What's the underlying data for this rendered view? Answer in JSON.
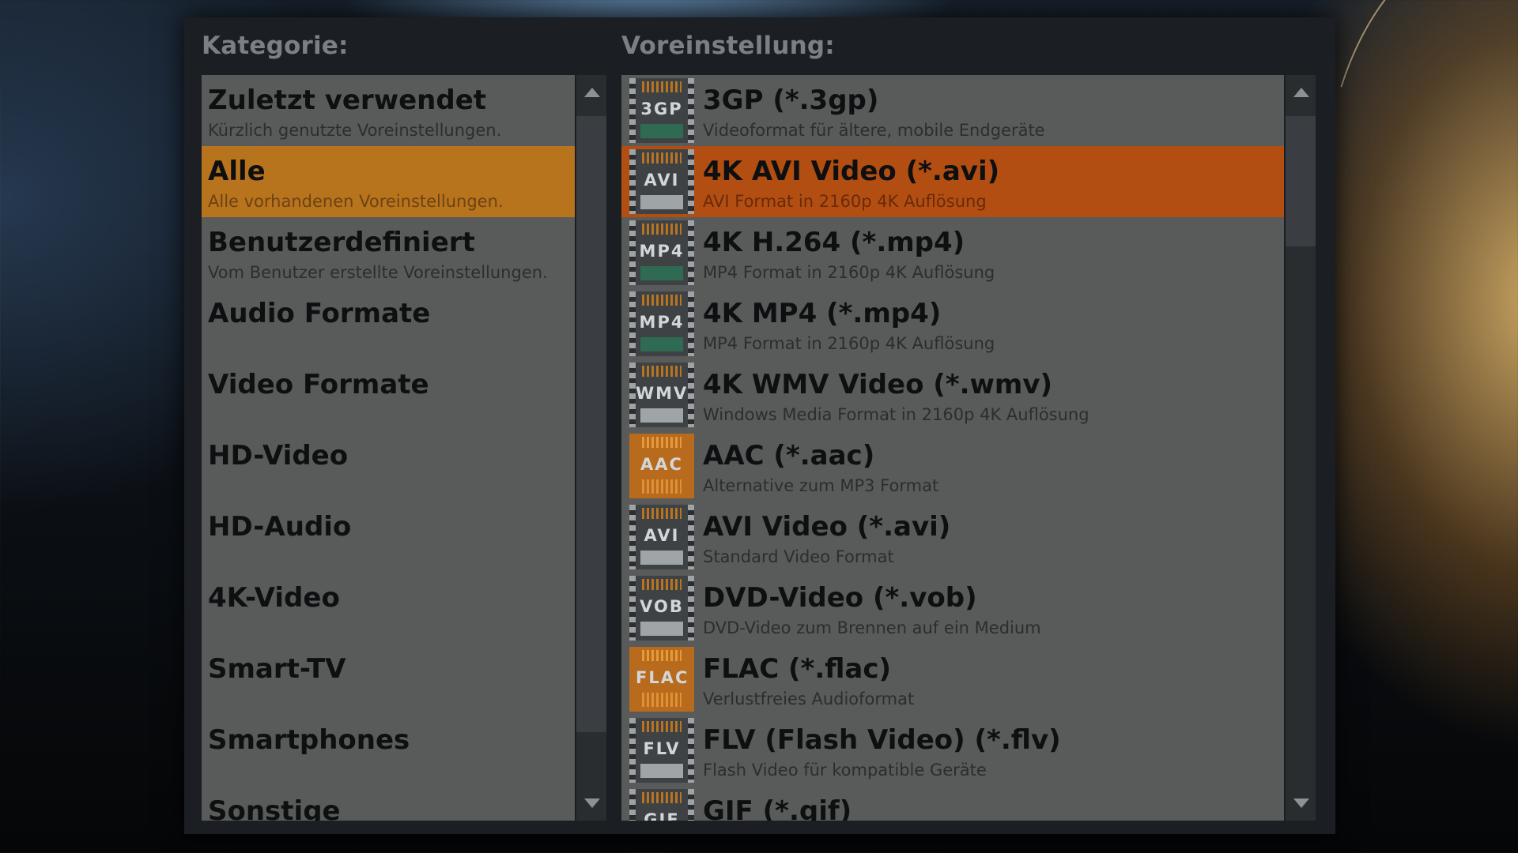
{
  "dialog": {
    "category_header": "Kategorie:",
    "preset_header": "Voreinstellung:"
  },
  "categories": [
    {
      "label": "Zuletzt verwendet",
      "desc": "Kürzlich genutzte Voreinstellungen.",
      "selected": false
    },
    {
      "label": "Alle",
      "desc": "Alle vorhandenen Voreinstellungen.",
      "selected": true
    },
    {
      "label": "Benutzerdefiniert",
      "desc": "Vom Benutzer erstellte Voreinstellungen.",
      "selected": false
    },
    {
      "label": "Audio Formate",
      "desc": "",
      "selected": false
    },
    {
      "label": "Video Formate",
      "desc": "",
      "selected": false
    },
    {
      "label": "HD-Video",
      "desc": "",
      "selected": false
    },
    {
      "label": "HD-Audio",
      "desc": "",
      "selected": false
    },
    {
      "label": "4K-Video",
      "desc": "",
      "selected": false
    },
    {
      "label": "Smart-TV",
      "desc": "",
      "selected": false
    },
    {
      "label": "Smartphones",
      "desc": "",
      "selected": false
    },
    {
      "label": "Sonstige",
      "desc": "",
      "selected": false
    }
  ],
  "presets": [
    {
      "label": "3GP (*.3gp)",
      "desc": "Videoformat für ältere, mobile Endgeräte",
      "icon_text": "3GP",
      "icon": "video-3gp-icon",
      "selected": false
    },
    {
      "label": "4K AVI Video (*.avi)",
      "desc": "AVI Format in 2160p 4K Auflösung",
      "icon_text": "AVI",
      "icon": "video-avi-icon",
      "selected": true
    },
    {
      "label": "4K H.264 (*.mp4)",
      "desc": "MP4 Format in 2160p 4K Auflösung",
      "icon_text": "MP4",
      "icon": "video-mp4-icon",
      "selected": false
    },
    {
      "label": "4K MP4 (*.mp4)",
      "desc": "MP4 Format in 2160p 4K Auflösung",
      "icon_text": "MP4",
      "icon": "video-mp4-icon",
      "selected": false
    },
    {
      "label": "4K WMV Video (*.wmv)",
      "desc": "Windows Media Format in 2160p 4K Auflösung",
      "icon_text": "WMV",
      "icon": "video-wmv-icon",
      "selected": false
    },
    {
      "label": "AAC (*.aac)",
      "desc": "Alternative zum MP3 Format",
      "icon_text": "AAC",
      "icon": "audio-aac-icon",
      "selected": false
    },
    {
      "label": "AVI Video (*.avi)",
      "desc": "Standard Video Format",
      "icon_text": "AVI",
      "icon": "video-avi-icon",
      "selected": false
    },
    {
      "label": "DVD-Video (*.vob)",
      "desc": "DVD-Video zum Brennen auf ein Medium",
      "icon_text": "VOB",
      "icon": "video-vob-icon",
      "selected": false
    },
    {
      "label": "FLAC (*.flac)",
      "desc": "Verlustfreies Audioformat",
      "icon_text": "FLAC",
      "icon": "audio-flac-icon",
      "selected": false
    },
    {
      "label": "FLV (Flash Video) (*.flv)",
      "desc": "Flash Video für kompatible Geräte",
      "icon_text": "FLV",
      "icon": "video-flv-icon",
      "selected": false
    },
    {
      "label": "GIF (*.gif)",
      "desc": "",
      "icon_text": "GIF",
      "icon": "video-gif-icon",
      "selected": false
    }
  ],
  "colors": {
    "selected_category": "#b8731d",
    "selected_preset": "#b34e13",
    "panel": "#595a5a",
    "window": "#1b1e22"
  }
}
